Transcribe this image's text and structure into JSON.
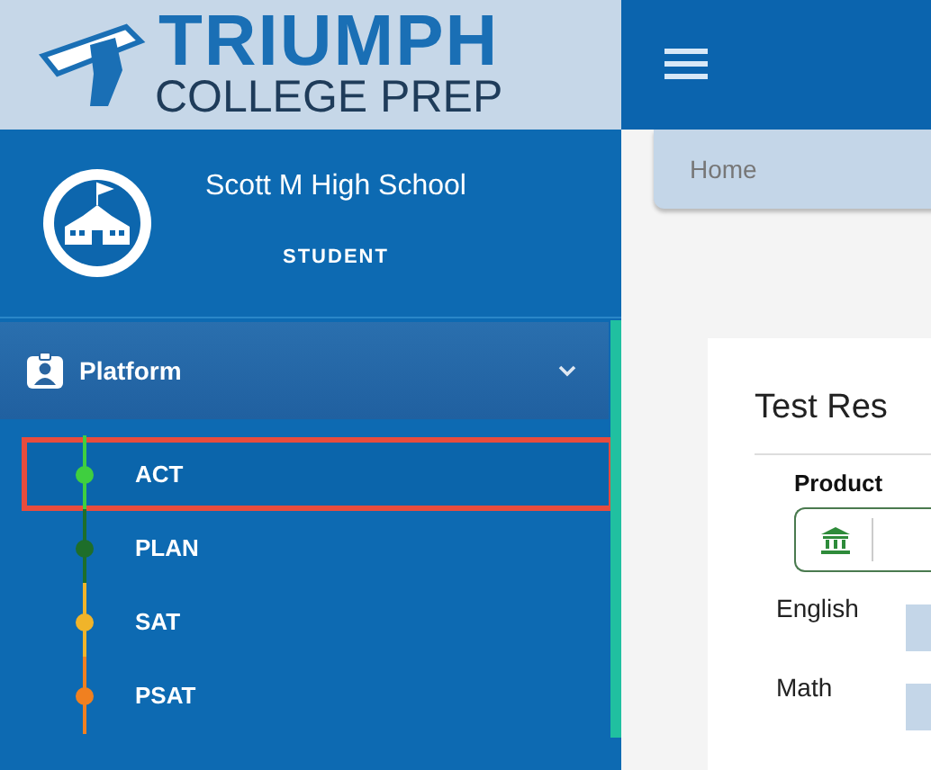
{
  "logo": {
    "line_1": "TRIUMPH",
    "line_2": "COLLEGE PREP"
  },
  "profile": {
    "school": "Scott M High School",
    "role": "STUDENT"
  },
  "menu": {
    "label": "Platform",
    "expanded": true,
    "items": [
      {
        "label": "ACT",
        "selected": true,
        "color": "#3fcf3f"
      },
      {
        "label": "PLAN",
        "selected": false,
        "color": "#1e6e2a"
      },
      {
        "label": "SAT",
        "selected": false,
        "color": "#f0b42a"
      },
      {
        "label": "PSAT",
        "selected": false,
        "color": "#f08020"
      }
    ]
  },
  "breadcrumb": "Home",
  "card": {
    "title": "Test Res",
    "product_label": "Product",
    "subjects": [
      {
        "label": "English"
      },
      {
        "label": "Math"
      }
    ]
  }
}
